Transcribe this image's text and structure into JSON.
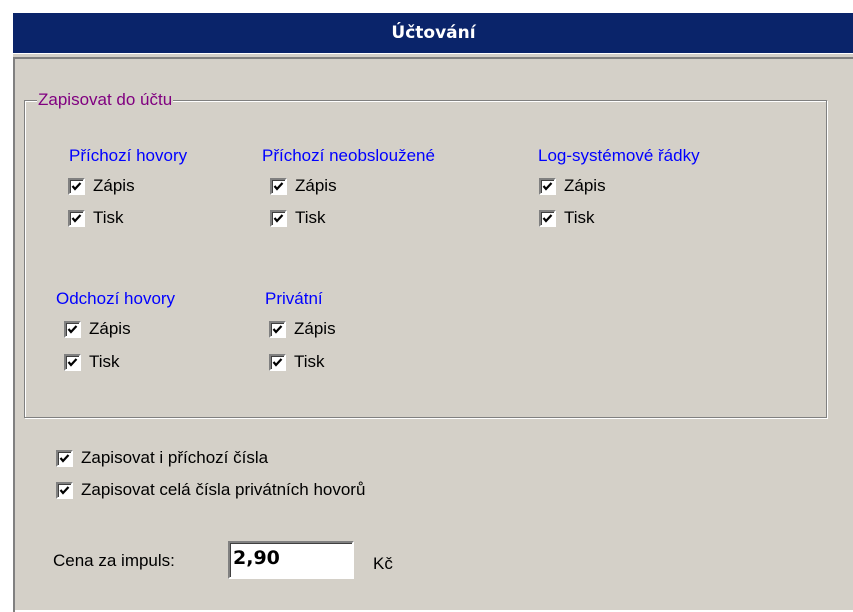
{
  "window": {
    "title": "Účtování"
  },
  "group": {
    "legend": "Zapisovat do účtu",
    "sections": {
      "incoming": {
        "title": "Příchozí hovory",
        "write_label": "Zápis",
        "write_checked": true,
        "print_label": "Tisk",
        "print_checked": true
      },
      "missed": {
        "title": "Příchozí neobsloužené",
        "write_label": "Zápis",
        "write_checked": true,
        "print_label": "Tisk",
        "print_checked": true
      },
      "log": {
        "title": "Log-systémové řádky",
        "write_label": "Zápis",
        "write_checked": true,
        "print_label": "Tisk",
        "print_checked": true
      },
      "outgoing": {
        "title": "Odchozí hovory",
        "write_label": "Zápis",
        "write_checked": true,
        "print_label": "Tisk",
        "print_checked": true
      },
      "private": {
        "title": "Privátní",
        "write_label": "Zápis",
        "write_checked": true,
        "print_label": "Tisk",
        "print_checked": true
      }
    }
  },
  "options": {
    "incoming_numbers_label": "Zapisovat i příchozí čísla",
    "incoming_numbers_checked": true,
    "full_private_numbers_label": "Zapisovat celá čísla privátních hovorů",
    "full_private_numbers_checked": true
  },
  "price": {
    "label": "Cena za impuls:",
    "value": "2,90",
    "unit": "Kč"
  },
  "icons": {
    "checkbox_check": "check-mark-icon"
  },
  "colors": {
    "titlebar": "#0a246a",
    "dialog_face": "#d4d0c8",
    "legend_text": "#800080",
    "section_title": "#0000ff"
  }
}
